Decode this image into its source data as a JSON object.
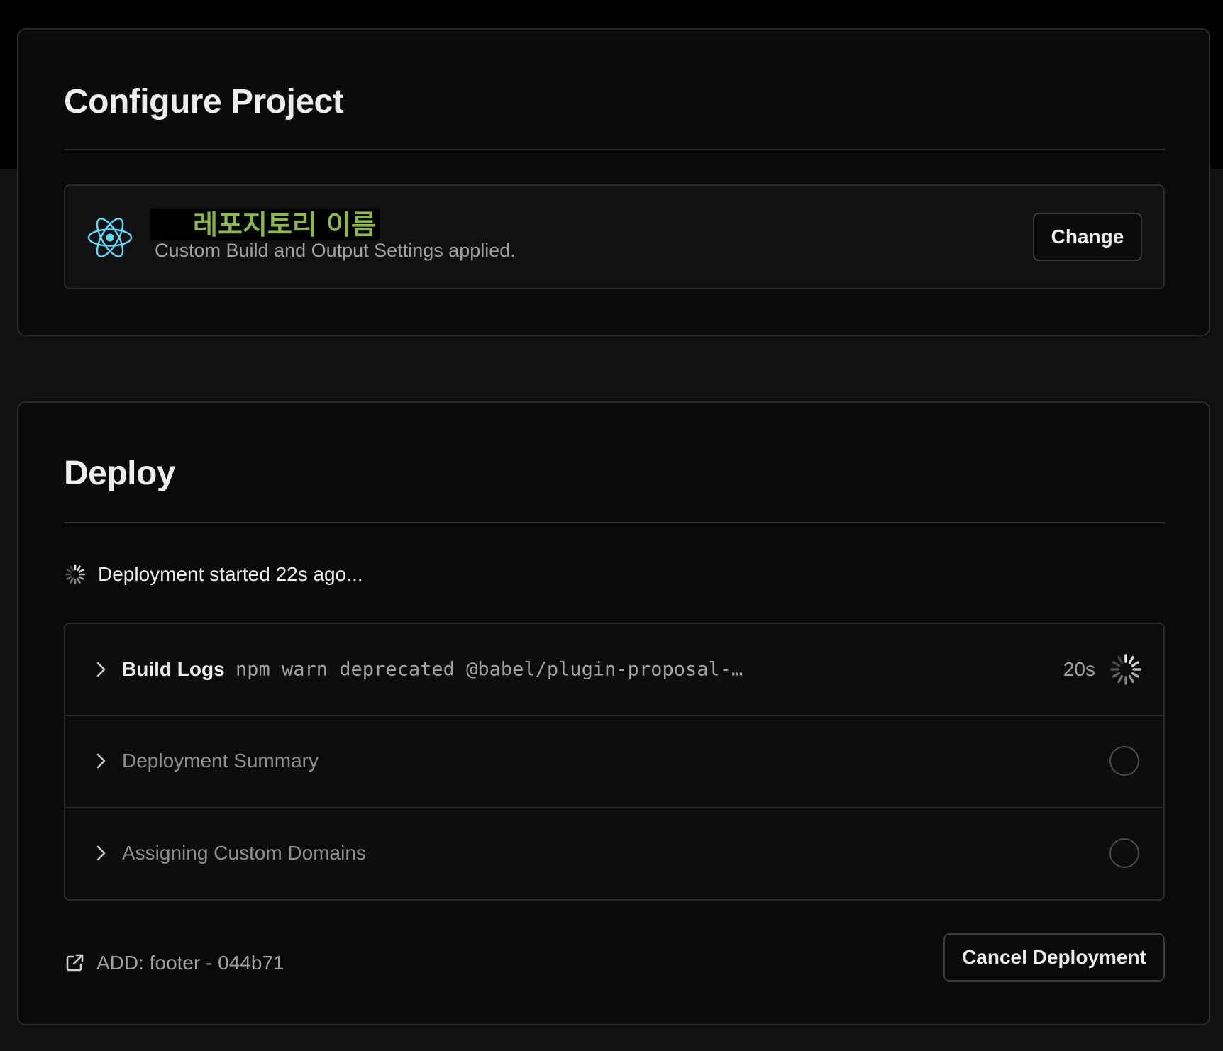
{
  "configure": {
    "title": "Configure Project",
    "repo_name": "레포지토리 이름",
    "repo_subtitle": "Custom Build and Output Settings applied.",
    "change_button": "Change",
    "framework_icon": "react-icon",
    "accent_color": "#8bb84a"
  },
  "deploy": {
    "title": "Deploy",
    "status": "Deployment started 22s ago...",
    "steps": [
      {
        "label": "Build Logs",
        "log": "npm warn deprecated @babel/plugin-proposal-…",
        "time": "20s",
        "state": "running"
      },
      {
        "label": "Deployment Summary",
        "state": "pending"
      },
      {
        "label": "Assigning Custom Domains",
        "state": "pending"
      }
    ],
    "commit": "ADD: footer - 044b71",
    "cancel_button": "Cancel Deployment"
  }
}
